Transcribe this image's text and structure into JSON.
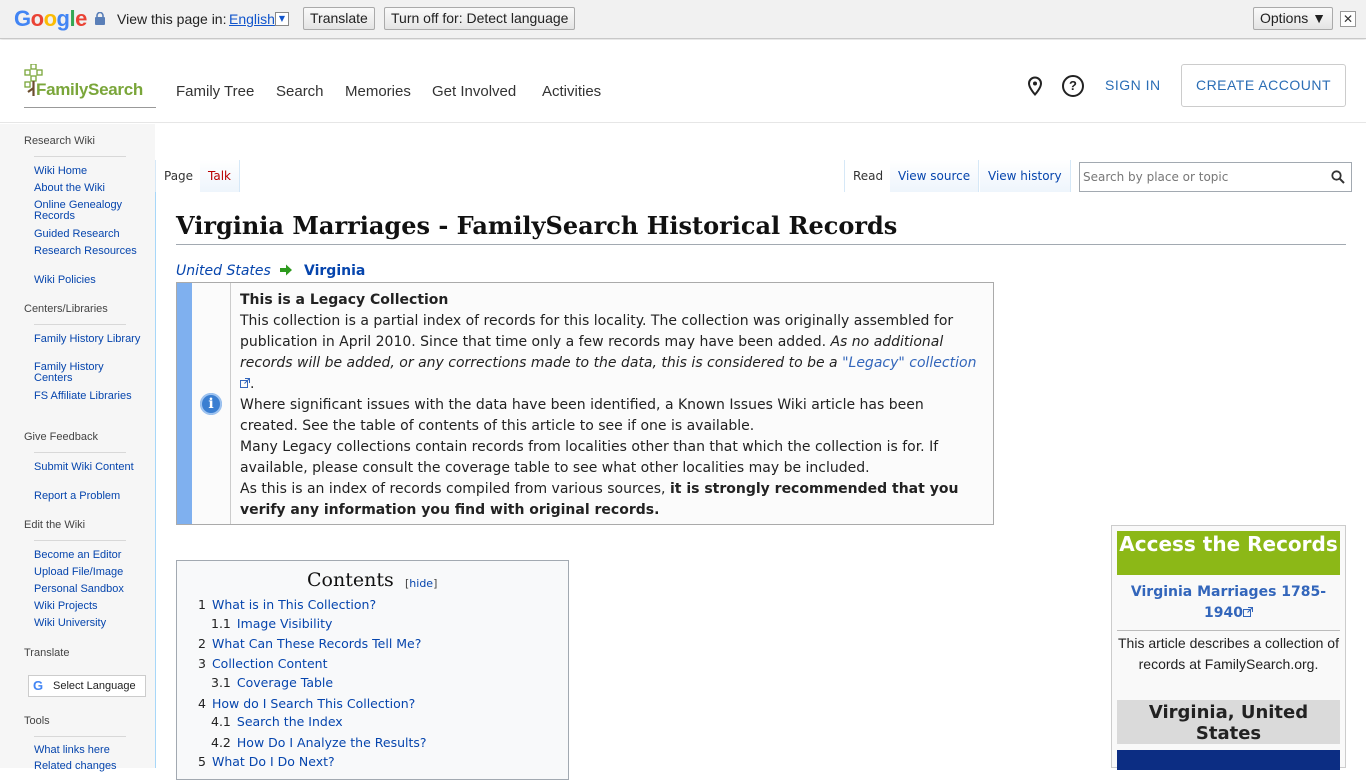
{
  "translate_bar": {
    "logo_letters": [
      {
        "ch": "G",
        "color": "#4285f4"
      },
      {
        "ch": "o",
        "color": "#ea4335"
      },
      {
        "ch": "o",
        "color": "#fbbc05"
      },
      {
        "ch": "g",
        "color": "#4285f4"
      },
      {
        "ch": "l",
        "color": "#34a853"
      },
      {
        "ch": "e",
        "color": "#ea4335"
      }
    ],
    "view_in_label": "View this page in:",
    "language": "English",
    "translate_button": "Translate",
    "turn_off_button": "Turn off for: Detect language",
    "options_button": "Options ▼",
    "close": "✕"
  },
  "header": {
    "logo_text": "FamilySearch",
    "nav": [
      "Family Tree",
      "Search",
      "Memories",
      "Get Involved",
      "Activities"
    ],
    "help_glyph": "?",
    "sign_in": "SIGN IN",
    "create_account": "CREATE ACCOUNT"
  },
  "sidebar": {
    "sections": [
      {
        "title": "Research Wiki",
        "items": [
          "Wiki Home",
          "About the Wiki",
          "Online Genealogy Records",
          "Guided Research",
          "Research Resources",
          "Wiki Policies"
        ]
      },
      {
        "title": "Centers/Libraries",
        "items": [
          "Family History Library",
          "Family History Centers",
          "FS Affiliate Libraries"
        ]
      },
      {
        "title": "Give Feedback",
        "items": [
          "Submit Wiki Content",
          "Report a Problem"
        ]
      },
      {
        "title": "Edit the Wiki",
        "items": [
          "Become an Editor",
          "Upload File/Image",
          "Personal Sandbox",
          "Wiki Projects",
          "Wiki University"
        ]
      },
      {
        "title": "Translate",
        "items": []
      },
      {
        "title": "Tools",
        "items": [
          "What links here",
          "Related changes"
        ]
      }
    ],
    "translate_label": "Select Language",
    "translate_g": "G"
  },
  "tabs": {
    "page": "Page",
    "talk": "Talk",
    "read": "Read",
    "view_source": "View source",
    "view_history": "View history",
    "search_placeholder": "Search by place or topic"
  },
  "article": {
    "title": "Virginia Marriages - FamilySearch Historical Records",
    "breadcrumb_parent": "United States",
    "breadcrumb_current": "Virginia",
    "info_glyph": "i",
    "legacy": {
      "heading": "This is a Legacy Collection",
      "p1_plain": "This collection is a partial index of records for this locality. The collection was originally assembled for publication in April 2010. Since that time only a few records may have been added. ",
      "p1_italic": "As no additional records will be added, or any corrections made to the data, this is considered to be a ",
      "p1_link": "\"Legacy\" collection",
      "p1_end": ".",
      "p2": "Where significant issues with the data have been identified, a Known Issues Wiki article has been created. See the table of contents of this article to see if one is available.",
      "p3": "Many Legacy collections contain records from localities other than that which the collection is for. If available, please consult the coverage table to see what other localities may be included.",
      "p4_plain": "As this is an index of records compiled from various sources, ",
      "p4_bold": "it is strongly recommended that you verify any information you find with original records."
    },
    "toc": {
      "title": "Contents",
      "hide_open": "[",
      "hide": "hide",
      "hide_close": "]",
      "items": [
        {
          "num": "1",
          "label": "What is in This Collection?",
          "level": 1
        },
        {
          "num": "1.1",
          "label": "Image Visibility",
          "level": 2
        },
        {
          "num": "2",
          "label": "What Can These Records Tell Me?",
          "level": 1
        },
        {
          "num": "3",
          "label": "Collection Content",
          "level": 1
        },
        {
          "num": "3.1",
          "label": "Coverage Table",
          "level": 2
        },
        {
          "num": "4",
          "label": "How do I Search This Collection?",
          "level": 1
        },
        {
          "num": "4.1",
          "label": "Search the Index",
          "level": 2
        },
        {
          "num": "4.2",
          "label": "How Do I Analyze the Results?",
          "level": 2
        },
        {
          "num": "5",
          "label": "What Do I Do Next?",
          "level": 1
        }
      ]
    },
    "infobox": {
      "access": "Access the Records",
      "collection_link": "Virginia Marriages 1785-1940",
      "description": "This article describes a collection of records at FamilySearch.org.",
      "place": "Virginia, United States"
    }
  },
  "colors": {
    "link": "#0645ad",
    "fs_green": "#7aa63a",
    "access_green": "#8cb817",
    "legacy_bar": "#7fb0ef"
  }
}
